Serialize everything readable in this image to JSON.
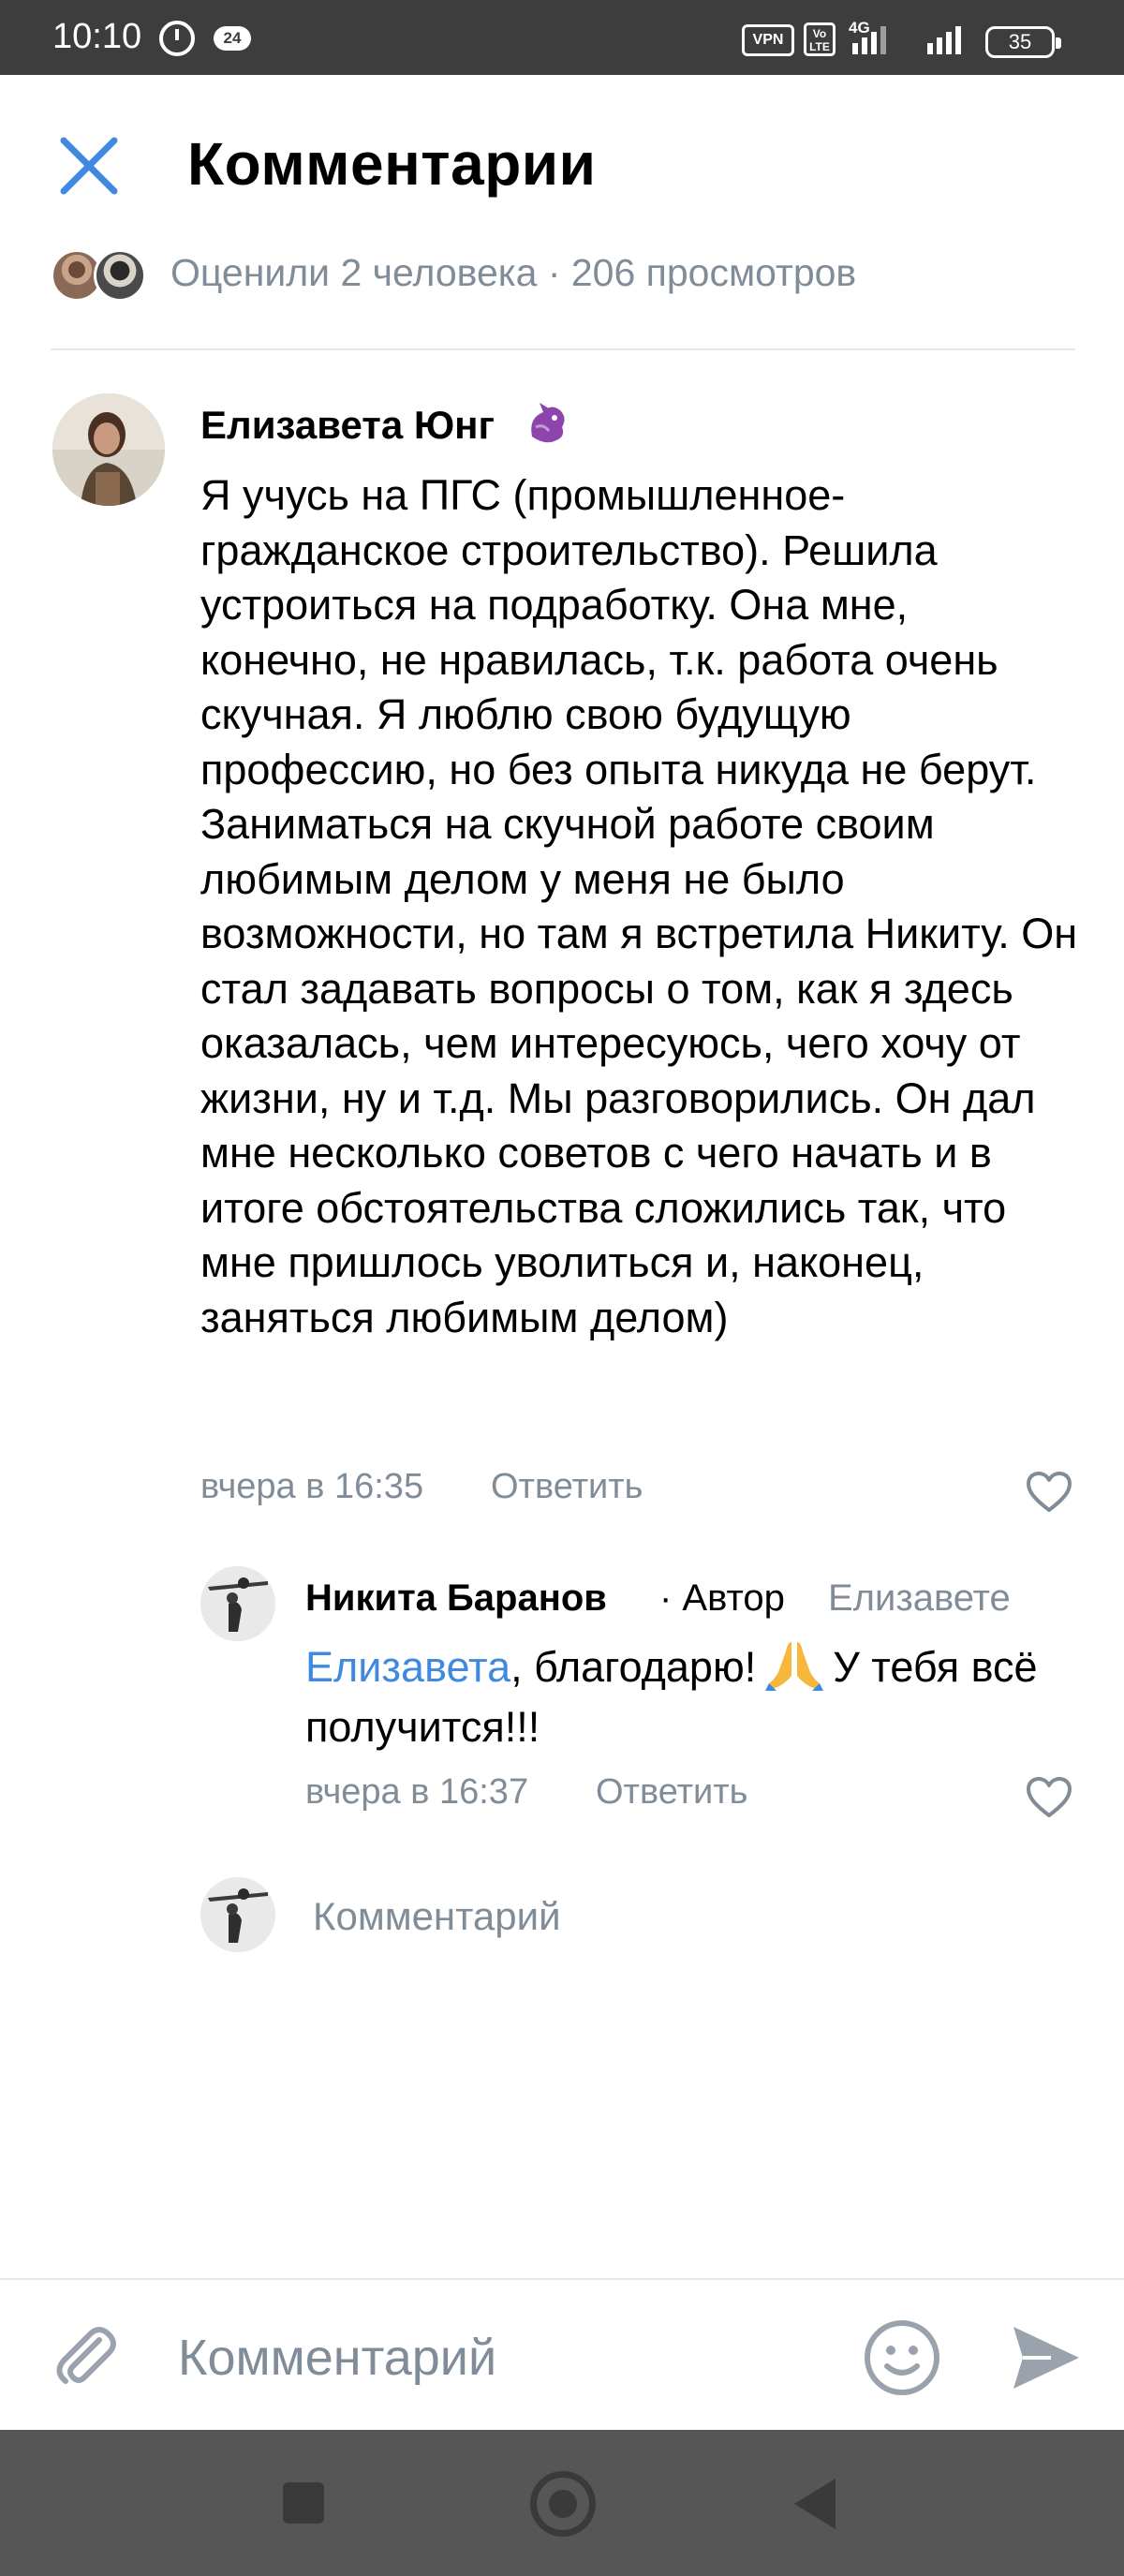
{
  "status_bar": {
    "time": "10:10",
    "notification_badge": "24",
    "vpn": "VPN",
    "volte": "Vo LTE",
    "network": "4G",
    "battery": "35"
  },
  "header": {
    "close_icon": "close-icon",
    "title": "Комментарии"
  },
  "likes_summary": "Оценили 2 человека · 206 просмотров",
  "comment": {
    "author": "Елизавета Юнг",
    "author_emoji": "purple-dragon-emoji",
    "text": "Я учусь на ПГС (промышленное-гражданское строительство). Решила устроиться на подработку. Она мне, конечно, не нравилась, т.к. работа очень скучная. Я люблю свою будущую профессию, но без опыта никуда не берут. Заниматься на скучной работе своим любимым делом у меня не было возможности, но там я встретила Никиту. Он стал задавать вопросы о том, как я здесь оказалась, чем интересуюсь, чего хочу от жизни, ну и т.д. Мы разговорились. Он дал мне несколько советов с чего начать и в итоге обстоятельства сложились так, что мне пришлось уволиться и, наконец, заняться любимым делом)",
    "time": "вчера в 16:35",
    "reply_label": "Ответить"
  },
  "reply": {
    "author": "Никита Баранов",
    "author_tag": "· Автор",
    "reply_to": "Елизавете",
    "mention": "Елизавета",
    "text_after_mention": ", благодарю!",
    "text_end": "У тебя всё получится!!!",
    "time": "вчера в 16:37",
    "reply_label": "Ответить"
  },
  "inline_comment_placeholder": "Комментарий",
  "input_bar": {
    "placeholder": "Комментарий",
    "attach_icon": "paperclip-icon",
    "emoji_icon": "smile-icon",
    "send_icon": "send-icon"
  },
  "colors": {
    "accent": "#3f8ae0",
    "secondary_text": "#818c99",
    "divider": "#e7e8ec"
  }
}
